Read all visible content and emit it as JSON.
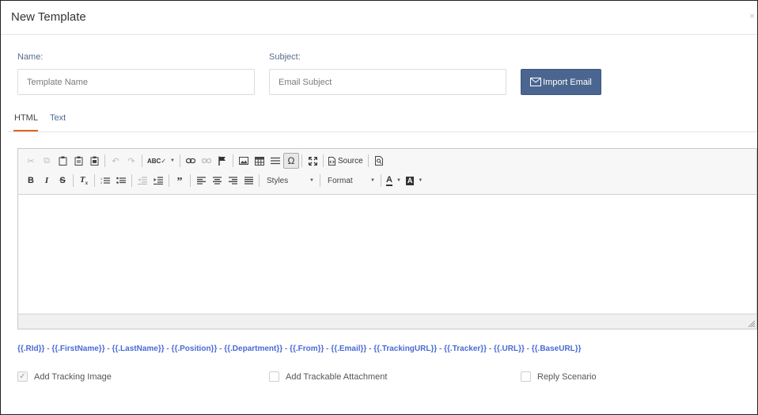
{
  "modal": {
    "title": "New Template",
    "close_glyph": "×"
  },
  "fields": {
    "name_label": "Name:",
    "name_placeholder": "Template Name",
    "subject_label": "Subject:",
    "subject_placeholder": "Email Subject"
  },
  "import_button": {
    "label": "Import Email",
    "icon": "envelope-icon"
  },
  "tabs": [
    {
      "label": "HTML",
      "active": true
    },
    {
      "label": "Text",
      "active": false
    }
  ],
  "toolbar": {
    "source_label": "Source",
    "styles_label": "Styles",
    "format_label": "Format",
    "row1_icons": [
      "cut-icon",
      "copy-icon",
      "paste-icon",
      "paste-text-icon",
      "paste-word-icon",
      "undo-icon",
      "redo-icon",
      "spellcheck-icon",
      "link-icon",
      "unlink-icon",
      "anchor-icon",
      "image-icon",
      "table-icon",
      "horizontal-rule-icon",
      "special-char-icon",
      "maximize-icon",
      "source-icon",
      "preview-icon"
    ],
    "row2_icons": [
      "bold-icon",
      "italic-icon",
      "strike-icon",
      "remove-format-icon",
      "numbered-list-icon",
      "bulleted-list-icon",
      "outdent-icon",
      "indent-icon",
      "blockquote-icon",
      "align-left-icon",
      "align-center-icon",
      "align-right-icon",
      "justify-icon",
      "text-color-icon",
      "background-color-icon"
    ]
  },
  "placeholders": [
    "{{.RId}}",
    "{{.FirstName}}",
    "{{.LastName}}",
    "{{.Position}}",
    "{{.Department}}",
    "{{.From}}",
    "{{.Email}}",
    "{{.TrackingURL}}",
    "{{.Tracker}}",
    "{{.URL}}",
    "{{.BaseURL}}"
  ],
  "placeholder_separator": " - ",
  "options": [
    {
      "label": "Add Tracking Image",
      "checked": true
    },
    {
      "label": "Add Trackable Attachment",
      "checked": false
    },
    {
      "label": "Reply Scenario",
      "checked": false
    }
  ],
  "colors": {
    "accent_button": "#4a6690",
    "tab_underline": "#e0661d",
    "placeholder_text": "#4a6ad6",
    "label_text": "#556c8c"
  }
}
